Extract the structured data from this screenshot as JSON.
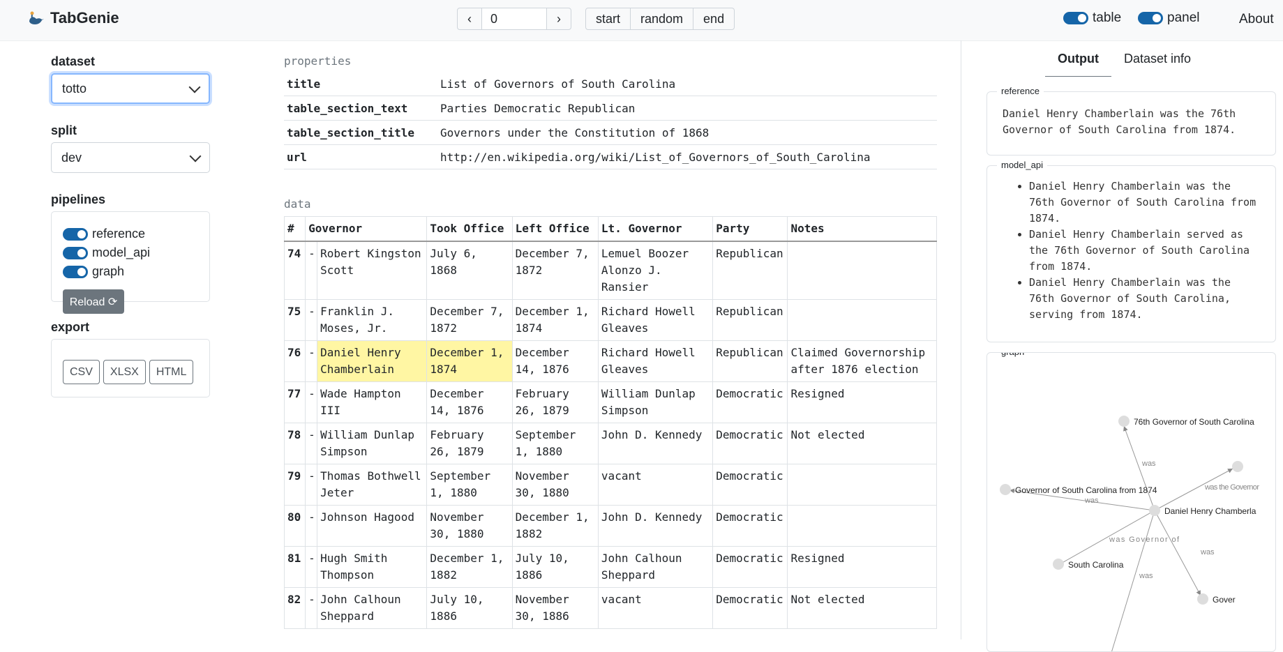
{
  "header": {
    "app_name": "TabGenie",
    "prev_label": "‹",
    "next_label": "›",
    "index_value": "0",
    "start_label": "start",
    "random_label": "random",
    "end_label": "end",
    "toggle_table_label": "table",
    "toggle_panel_label": "panel",
    "about_label": "About",
    "accent_color": "#1565a8"
  },
  "sidebar": {
    "dataset_label": "dataset",
    "dataset_value": "totto",
    "split_label": "split",
    "split_value": "dev",
    "pipelines_label": "pipelines",
    "pipelines": [
      "reference",
      "model_api",
      "graph"
    ],
    "reload_label": "Reload ⟳",
    "export_label": "export",
    "export_buttons": [
      "CSV",
      "XLSX",
      "HTML"
    ]
  },
  "main": {
    "properties_label": "properties",
    "properties": [
      {
        "key": "title",
        "value": "List of Governors of South Carolina"
      },
      {
        "key": "table_section_text",
        "value": "Parties Democratic Republican"
      },
      {
        "key": "table_section_title",
        "value": "Governors under the Constitution of 1868"
      },
      {
        "key": "url",
        "value": "http://en.wikipedia.org/wiki/List_of_Governors_of_South_Carolina"
      }
    ],
    "data_label": "data",
    "columns": [
      "#",
      "Governor",
      "Took Office",
      "Left Office",
      "Lt. Governor",
      "Party",
      "Notes"
    ],
    "rows": [
      [
        "74",
        "-",
        "Robert Kingston Scott",
        "July 6, 1868",
        "December 7, 1872",
        "Lemuel Boozer Alonzo J. Ransier",
        "Republican",
        ""
      ],
      [
        "75",
        "-",
        "Franklin J. Moses, Jr.",
        "December 7, 1872",
        "December 1, 1874",
        "Richard Howell Gleaves",
        "Republican",
        ""
      ],
      [
        "76",
        "-",
        "Daniel Henry Chamberlain",
        "December 1, 1874",
        "December 14, 1876",
        "Richard Howell Gleaves",
        "Republican",
        "Claimed Governorship after 1876 election"
      ],
      [
        "77",
        "-",
        "Wade Hampton III",
        "December 14, 1876",
        "February 26, 1879",
        "William Dunlap Simpson",
        "Democratic",
        "Resigned"
      ],
      [
        "78",
        "-",
        "William Dunlap Simpson",
        "February 26, 1879",
        "September 1, 1880",
        "John D. Kennedy",
        "Democratic",
        "Not elected"
      ],
      [
        "79",
        "-",
        "Thomas Bothwell Jeter",
        "September 1, 1880",
        "November 30, 1880",
        "vacant",
        "Democratic",
        ""
      ],
      [
        "80",
        "-",
        "Johnson Hagood",
        "November 30, 1880",
        "December 1, 1882",
        "John D. Kennedy",
        "Democratic",
        ""
      ],
      [
        "81",
        "-",
        "Hugh Smith Thompson",
        "December 1, 1882",
        "July 10, 1886",
        "John Calhoun Sheppard",
        "Democratic",
        "Resigned"
      ],
      [
        "82",
        "-",
        "John Calhoun Sheppard",
        "July 10, 1886",
        "November 30, 1886",
        "vacant",
        "Democratic",
        "Not elected"
      ]
    ],
    "highlight_color": "#fff6a3"
  },
  "panel": {
    "tabs": [
      "Output",
      "Dataset info"
    ],
    "reference_legend": "reference",
    "reference_text": "Daniel Henry Chamberlain was the 76th Governor of South Carolina from 1874.",
    "model_api_legend": "model_api",
    "model_api_items": [
      "Daniel Henry Chamberlain was the 76th Governor of South Carolina from 1874.",
      "Daniel Henry Chamberlain served as the 76th Governor of South Carolina from 1874.",
      "Daniel Henry Chamberlain was the 76th Governor of South Carolina, serving from 1874."
    ],
    "graph_legend": "graph",
    "graph_node_labels": [
      "76th Governor of South Carolina",
      "Governor of South Carolina from 1874",
      "Daniel Henry Chamberla",
      "South Carolina",
      "Gover"
    ],
    "graph_edge_labels": [
      "was",
      "was",
      "was the Governor",
      "was Governor of",
      "was",
      "was"
    ]
  }
}
